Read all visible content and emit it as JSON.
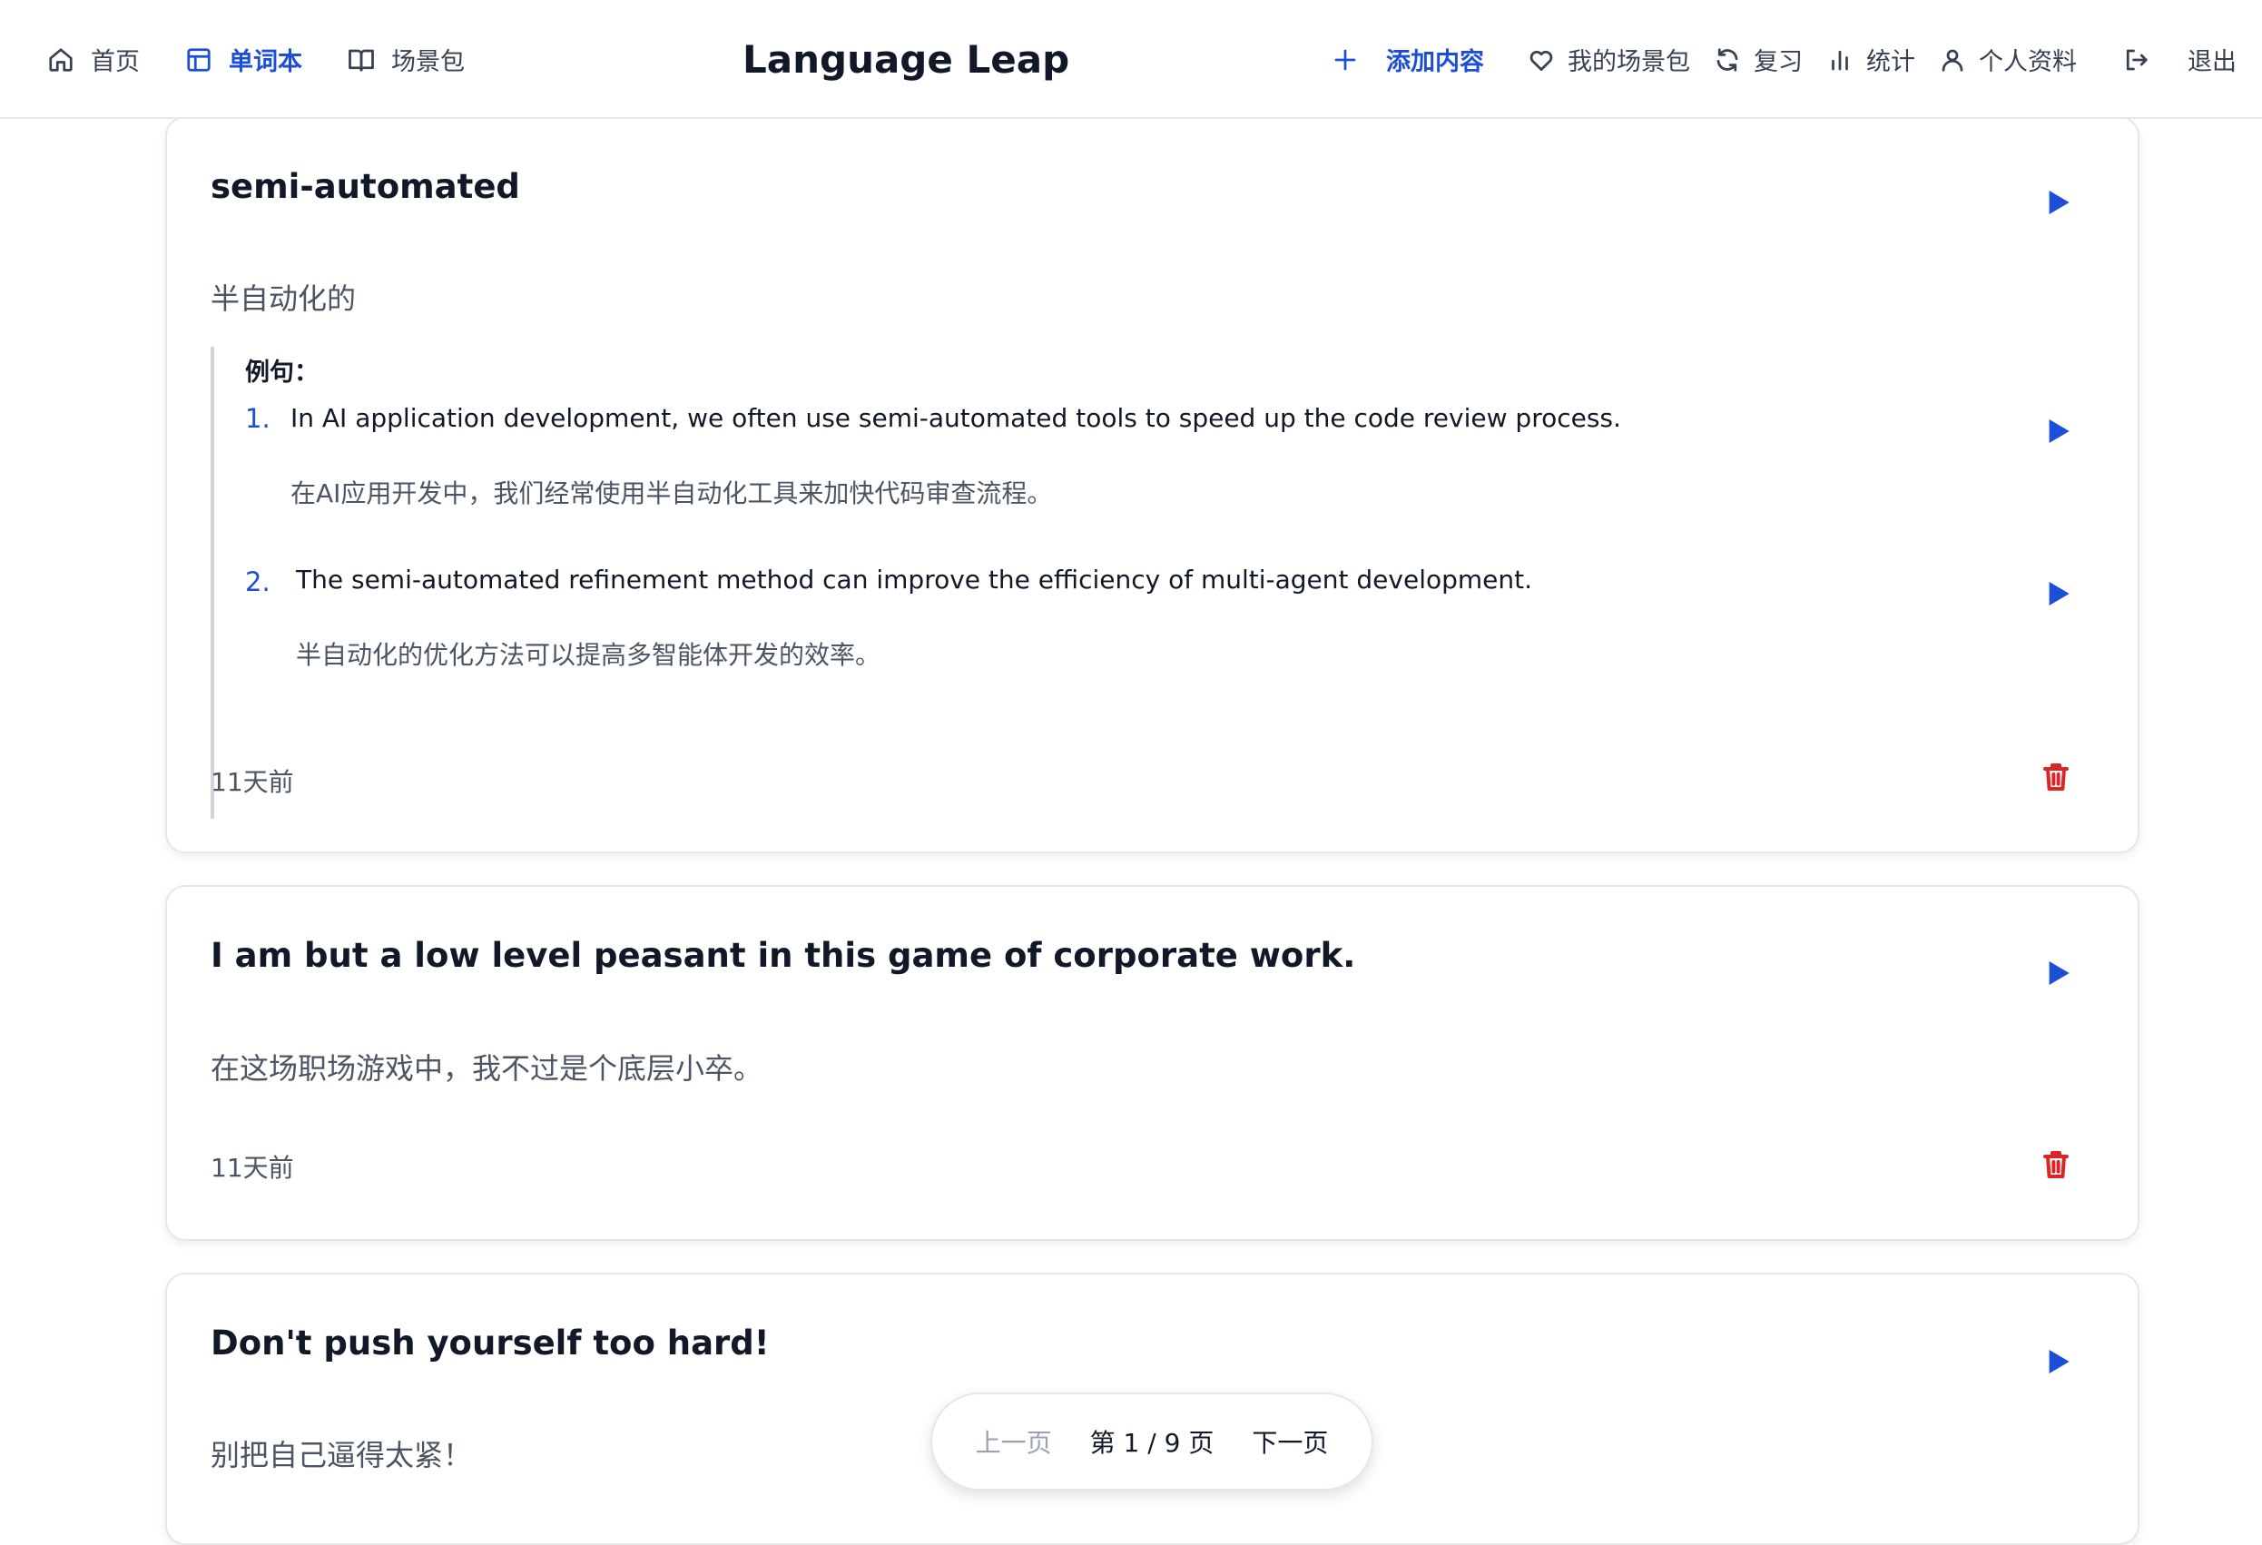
{
  "nav": {
    "home_label": "首页",
    "wordbook_label": "单词本",
    "scene_packs_label": "场景包",
    "brand": "Language Leap",
    "add_content_label": "添加内容",
    "my_scene_packs_label": "我的场景包",
    "review_label": "复习",
    "stats_label": "统计",
    "profile_label": "个人资料",
    "logout_label": "退出"
  },
  "cards": [
    {
      "term": "semi-automated",
      "translation": "半自动化的",
      "examples_heading": "例句：",
      "examples": [
        {
          "num": "1.",
          "en": "In AI application development, we often use semi-automated tools to speed up the code review process.",
          "zh": "在AI应用开发中，我们经常使用半自动化工具来加快代码审查流程。"
        },
        {
          "num": "2.",
          "en": "The semi-automated refinement method can improve the efficiency of multi-agent development.",
          "zh": "半自动化的优化方法可以提高多智能体开发的效率。"
        }
      ],
      "time": "11天前"
    },
    {
      "term": "I am but a low level peasant in this game of corporate work.",
      "translation": "在这场职场游戏中，我不过是个底层小卒。",
      "time": "11天前"
    },
    {
      "term": "Don't push yourself too hard!",
      "translation": "别把自己逼得太紧！"
    }
  ],
  "pagination": {
    "prev_label": "上一页",
    "page_info": "第 1 / 9 页",
    "next_label": "下一页"
  },
  "colors": {
    "accent": "#1d4ed8",
    "danger": "#dc2626",
    "muted": "#4b5563"
  }
}
